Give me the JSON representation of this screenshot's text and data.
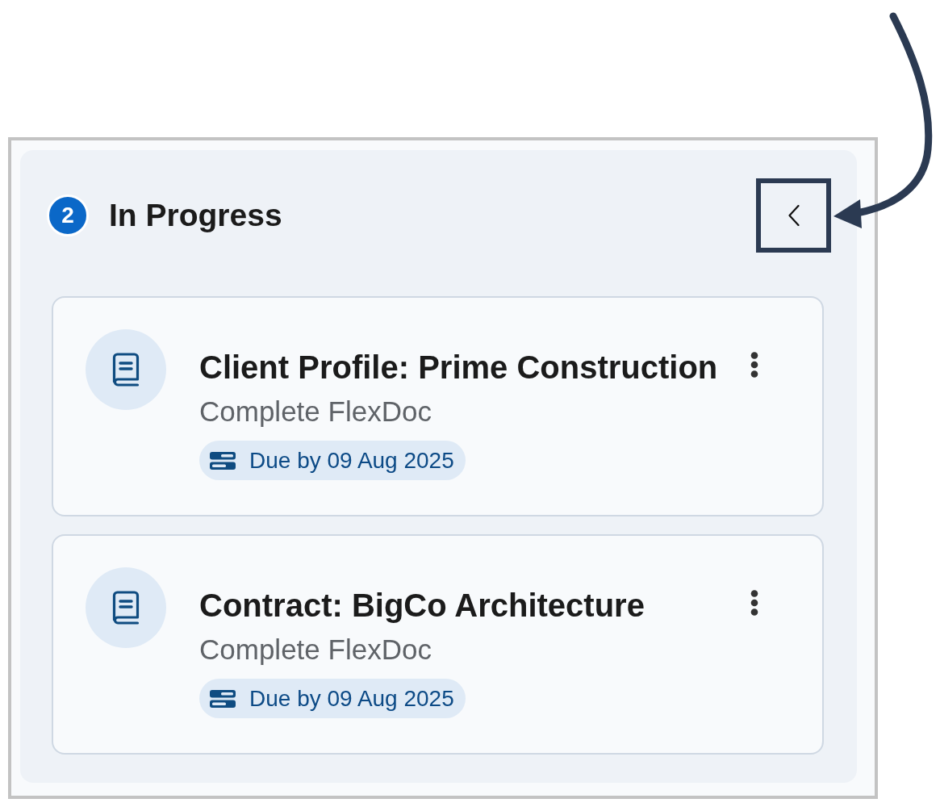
{
  "column": {
    "count": "2",
    "title": "In Progress",
    "collapse_button": {
      "highlighted": true
    }
  },
  "cards": [
    {
      "title": "Client Profile: Prime Construction",
      "subtitle": "Complete FlexDoc",
      "due": "Due by 09 Aug 2025"
    },
    {
      "title": "Contract: BigCo Architecture",
      "subtitle": "Complete FlexDoc",
      "due": "Due by 09 Aug 2025"
    }
  ]
}
